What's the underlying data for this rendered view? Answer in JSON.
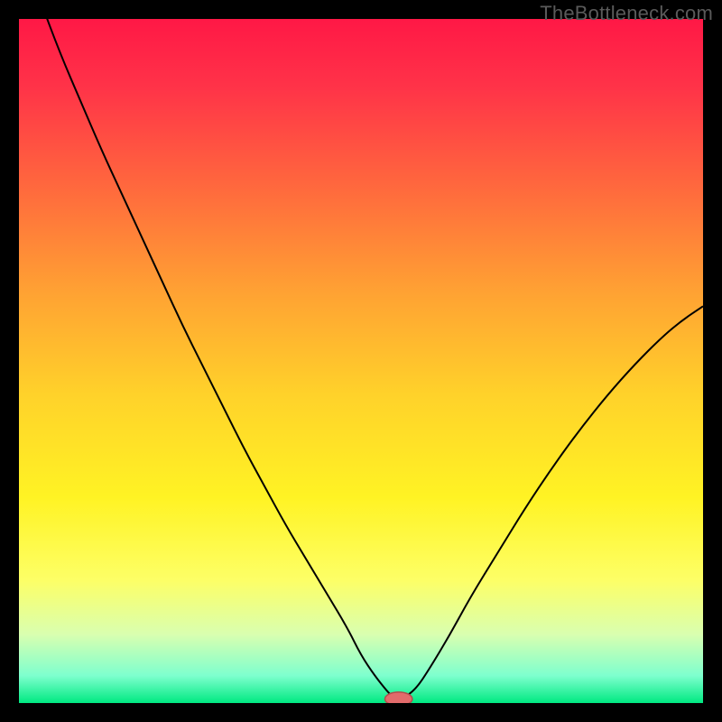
{
  "watermark": "TheBottleneck.com",
  "chart_data": {
    "type": "line",
    "title": "",
    "xlabel": "",
    "ylabel": "",
    "xlim": [
      0,
      100
    ],
    "ylim": [
      0,
      100
    ],
    "grid": false,
    "legend": false,
    "background_gradient": {
      "stops": [
        {
          "offset": 0.0,
          "color": "#ff1846"
        },
        {
          "offset": 0.1,
          "color": "#ff3348"
        },
        {
          "offset": 0.25,
          "color": "#ff6a3d"
        },
        {
          "offset": 0.4,
          "color": "#ffa233"
        },
        {
          "offset": 0.55,
          "color": "#ffd22a"
        },
        {
          "offset": 0.7,
          "color": "#fff324"
        },
        {
          "offset": 0.82,
          "color": "#fdff66"
        },
        {
          "offset": 0.9,
          "color": "#d9ffb0"
        },
        {
          "offset": 0.96,
          "color": "#7effce"
        },
        {
          "offset": 1.0,
          "color": "#00e981"
        }
      ]
    },
    "series": [
      {
        "name": "bottleneck-curve",
        "stroke": "#000000",
        "x": [
          0,
          3,
          6,
          9,
          12,
          15,
          18,
          21,
          24,
          27,
          30,
          33,
          36,
          39,
          42,
          45,
          48,
          50,
          52,
          54,
          55,
          56,
          58,
          60,
          63,
          66,
          70,
          74,
          78,
          82,
          86,
          90,
          94,
          97,
          100
        ],
        "y": [
          112,
          103,
          95,
          88,
          81,
          74.5,
          68,
          61.5,
          55,
          49,
          43,
          37,
          31.5,
          26,
          21,
          16,
          11,
          7,
          4,
          1.5,
          0.6,
          0.6,
          2,
          5,
          10,
          15.5,
          22,
          28.5,
          34.5,
          40,
          45,
          49.5,
          53.5,
          56,
          58
        ]
      }
    ],
    "marker": {
      "name": "target-marker",
      "x": 55.5,
      "y": 0.6,
      "rx": 2.0,
      "ry": 1.0,
      "fill": "#e26b6b",
      "stroke": "#b24d4d"
    }
  }
}
